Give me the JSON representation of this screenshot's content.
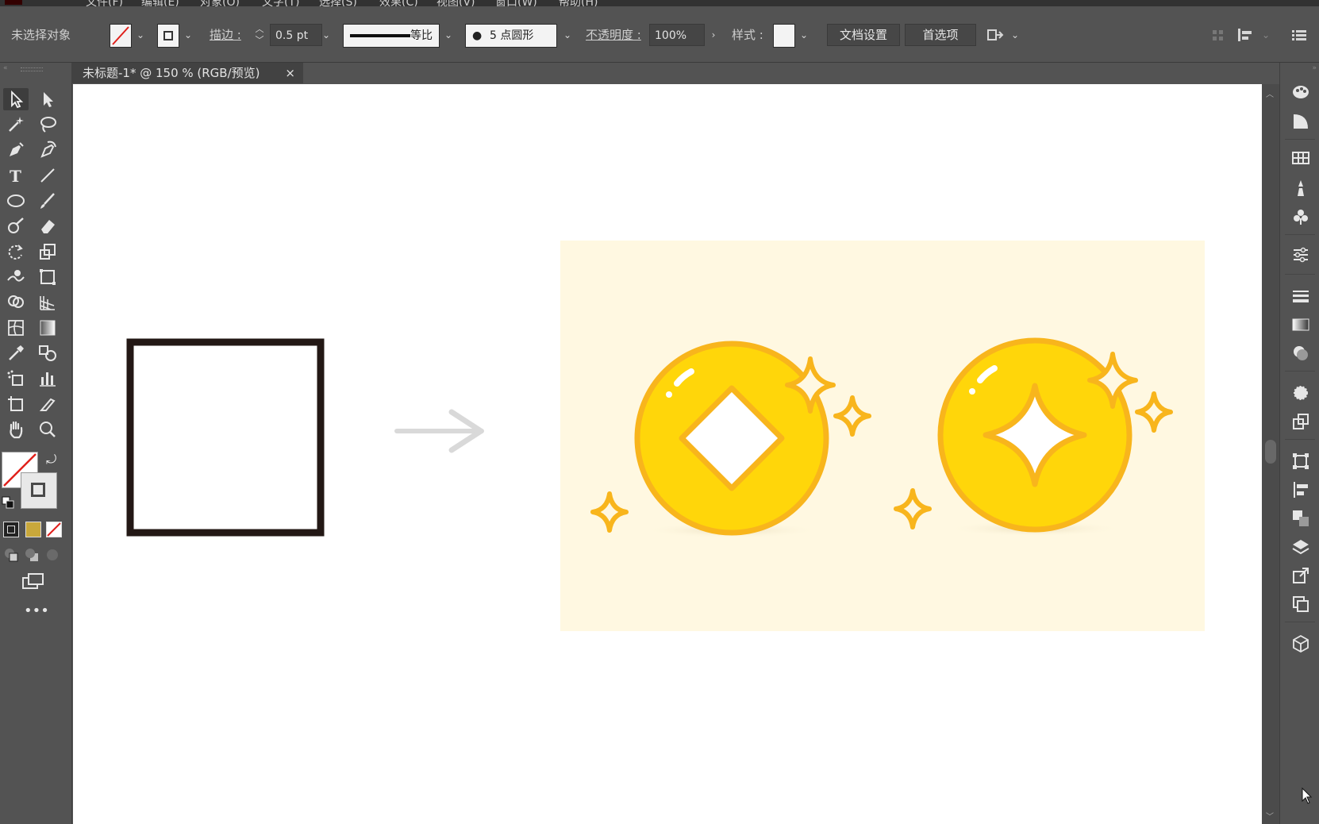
{
  "menubar": {
    "items": [
      "文件(F)",
      "编辑(E)",
      "对象(O)",
      "文字(T)",
      "选择(S)",
      "效果(C)",
      "视图(V)",
      "窗口(W)",
      "帮助(H)"
    ]
  },
  "controlbar": {
    "no_selection": "未选择对象",
    "stroke_label": "描边 :",
    "stroke_value": "0.5 pt",
    "stroke_profile": "等比",
    "brush_value": "5 点圆形",
    "opacity_label": "不透明度 :",
    "opacity_value": "100%",
    "style_label": "样式 :",
    "doc_setup_button": "文档设置",
    "preferences_button": "首选项"
  },
  "document_tab": {
    "title": "未标题-1* @ 150 % (RGB/预览)",
    "close": "×"
  },
  "colors": {
    "ui_bg": "#535353",
    "canvas": "#ffffff",
    "artboard_bg": "#fff8e1",
    "coin_yellow": "#ffd60a",
    "coin_outline": "#f8b51c",
    "square_stroke": "#231815",
    "arrow": "#d9d9d9"
  },
  "icons": {
    "left_tools": [
      "selection-tool",
      "direct-selection-tool",
      "magic-wand-tool",
      "lasso-tool",
      "pen-tool",
      "curvature-tool",
      "type-tool",
      "line-tool",
      "ellipse-tool",
      "paintbrush-tool",
      "shaper-tool",
      "eraser-tool",
      "rotate-tool",
      "scale-tool",
      "warp-tool",
      "free-transform-tool",
      "shape-builder-tool",
      "perspective-grid-tool",
      "mesh-tool",
      "gradient-tool",
      "eyedropper-tool",
      "blend-tool",
      "symbol-sprayer-tool",
      "column-graph-tool",
      "artboard-tool",
      "slice-tool",
      "hand-tool",
      "zoom-tool"
    ],
    "right_panels": [
      "color-panel",
      "color-guide-panel",
      "swatches-panel",
      "brushes-panel",
      "symbols-panel",
      "properties-panel",
      "stroke-panel",
      "gradient-panel",
      "transparency-panel",
      "appearance-panel",
      "graphic-styles-panel",
      "transform-panel",
      "align-panel",
      "pathfinder-panel",
      "layers-panel",
      "export-panel",
      "artboards-panel",
      "3d-panel"
    ]
  }
}
